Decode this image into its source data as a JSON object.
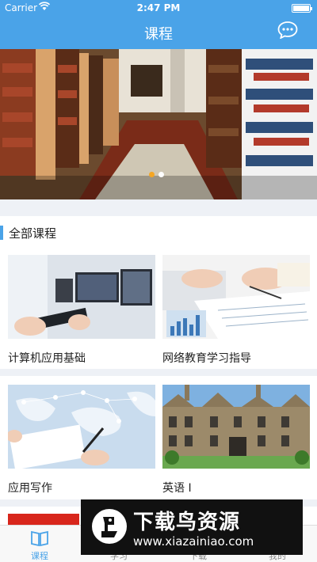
{
  "status_bar": {
    "carrier": "Carrier",
    "time": "2:47 PM"
  },
  "nav": {
    "title": "课程"
  },
  "banner": {
    "active_dot": 0,
    "dot_count": 2,
    "colors": {
      "active": "#f5a623",
      "inactive": "#ffffff"
    }
  },
  "section": {
    "title": "全部课程"
  },
  "courses": [
    {
      "title": "计算机应用基础"
    },
    {
      "title": "网络教育学习指导"
    },
    {
      "title": "应用写作"
    },
    {
      "title": "英语 I"
    }
  ],
  "tabs": [
    {
      "label": "课程",
      "icon": "book-icon",
      "active": true
    },
    {
      "label": "学习",
      "icon": "study-icon",
      "active": false
    },
    {
      "label": "下载",
      "icon": "download-icon",
      "active": false
    },
    {
      "label": "我的",
      "icon": "profile-icon",
      "active": false
    }
  ],
  "watermark": {
    "text": "下载鸟资源",
    "url": "www.xiazainiao.com"
  },
  "colors": {
    "accent": "#4aa3e8",
    "background": "#eef1f6"
  }
}
